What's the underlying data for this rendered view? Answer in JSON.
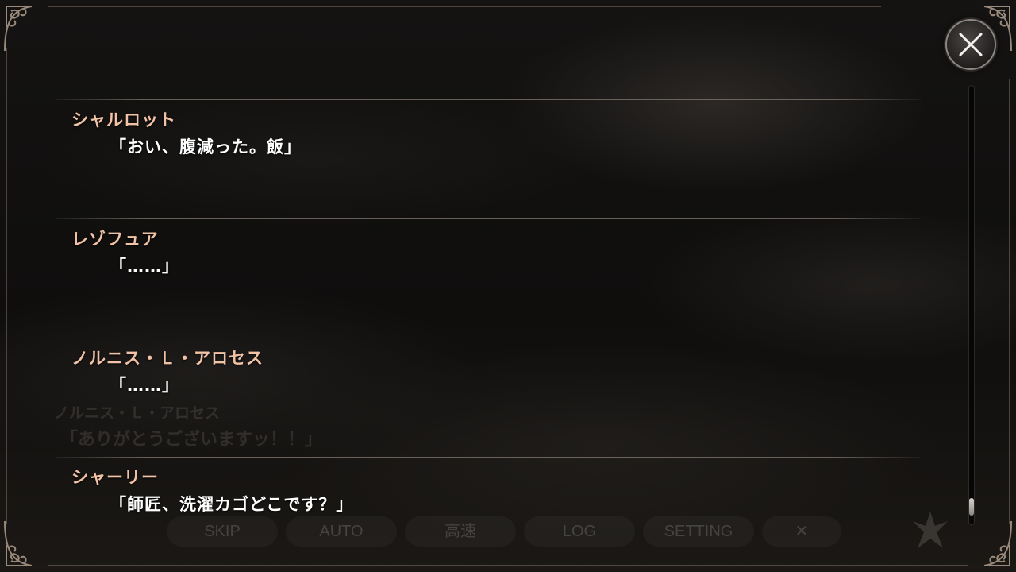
{
  "log": {
    "entries": [
      {
        "speaker": "シャルロット",
        "line": "「おい、腹減った。飯」"
      },
      {
        "speaker": "レゾフュア",
        "line": "「……」"
      },
      {
        "speaker": "ノルニス・Ｌ・アロセス",
        "line": "「……」"
      },
      {
        "speaker": "シャーリー",
        "line": "「師匠、洗濯カゴどこです？」"
      }
    ]
  },
  "background_scene": {
    "speaker": "ノルニス・Ｌ・アロセス",
    "line": "「ありがとうございますッ！！」",
    "menu": [
      "SKIP",
      "AUTO",
      "高速",
      "LOG",
      "SETTING",
      "✕"
    ]
  },
  "close_button": {
    "icon": "close-icon"
  },
  "scrollbar": {
    "position_fraction": 0.98
  },
  "colors": {
    "speaker": "#f1c2a6",
    "line": "#ffffff",
    "background": "#0d0c0b"
  }
}
